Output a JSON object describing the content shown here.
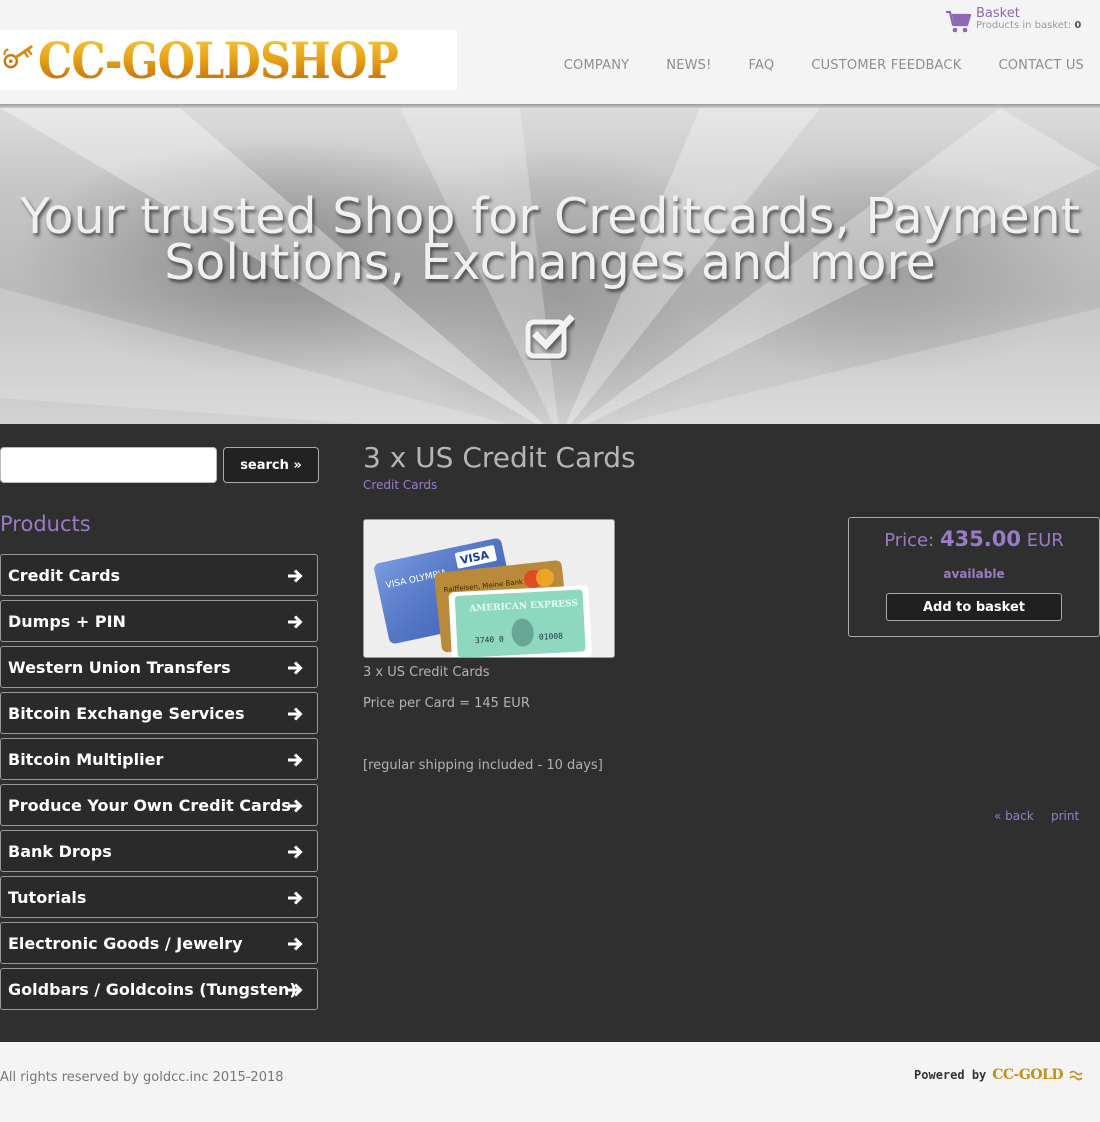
{
  "header": {
    "logo_text": "CC-GOLDSHOP",
    "basket": {
      "title": "Basket",
      "count_label": "Products in basket:",
      "count": "0"
    },
    "nav": [
      "COMPANY",
      "NEWS!",
      "FAQ",
      "CUSTOMER FEEDBACK",
      "CONTACT US"
    ]
  },
  "hero": {
    "title_line1": "Your trusted Shop for Creditcards, Payment",
    "title_line2": "Solutions, Exchanges and more",
    "icon": "check-square-icon"
  },
  "sidebar": {
    "search": {
      "value": "",
      "button_label": "search »"
    },
    "products_heading": "Products",
    "categories": [
      "Credit Cards",
      "Dumps + PIN",
      "Western Union Transfers",
      "Bitcoin Exchange Services",
      "Bitcoin Multiplier",
      "Produce Your Own Credit Cards",
      "Bank Drops",
      "Tutorials",
      "Electronic Goods / Jewelry",
      "Goldbars / Goldcoins (Tungsten)"
    ]
  },
  "product": {
    "title": "3 x US Credit Cards",
    "category": "Credit Cards",
    "image_alt": "credit cards photo",
    "description": [
      "3 x US Credit Cards",
      "Price per Card = 145 EUR",
      "[regular shipping included - 10 days]"
    ],
    "price_label": "Price:",
    "price": "435.00",
    "currency": "EUR",
    "availability": "available",
    "add_button": "Add to basket",
    "back_link": "« back",
    "print_link": "print"
  },
  "footer": {
    "copyright": "All rights reserved by goldcc.inc 2015-2018",
    "powered_label": "Powered by",
    "powered_brand": "CC-GOLD"
  },
  "colors": {
    "accent": "#9a7cc4",
    "background": "#2f2f2f",
    "header": "#f4f4f4",
    "logo_gold": "#e2a21a"
  }
}
